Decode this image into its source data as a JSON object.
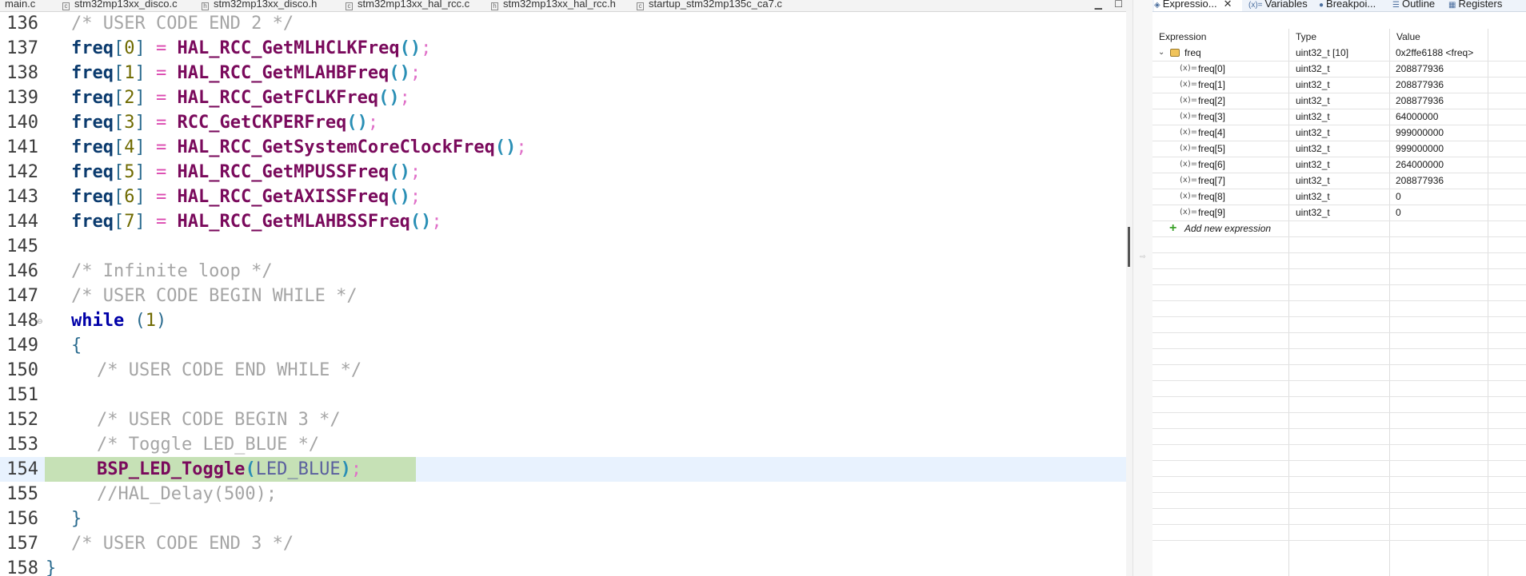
{
  "editor": {
    "tabs": [
      {
        "label": "main.c"
      },
      {
        "label": "stm32mp13xx_disco.c"
      },
      {
        "label": "stm32mp13xx_disco.h"
      },
      {
        "label": "stm32mp13xx_hal_rcc.c"
      },
      {
        "label": "stm32mp13xx_hal_rcc.h"
      },
      {
        "label": "startup_stm32mp135c_ca7.c"
      }
    ],
    "lines": [
      {
        "n": "136",
        "text": "/* USER CODE END 2 */"
      },
      {
        "n": "137",
        "var": "freq",
        "idx": "0",
        "fn": "HAL_RCC_GetMLHCLKFreq"
      },
      {
        "n": "138",
        "var": "freq",
        "idx": "1",
        "fn": "HAL_RCC_GetMLAHBFreq"
      },
      {
        "n": "139",
        "var": "freq",
        "idx": "2",
        "fn": "HAL_RCC_GetFCLKFreq"
      },
      {
        "n": "140",
        "var": "freq",
        "idx": "3",
        "fn": "RCC_GetCKPERFreq"
      },
      {
        "n": "141",
        "var": "freq",
        "idx": "4",
        "fn": "HAL_RCC_GetSystemCoreClockFreq"
      },
      {
        "n": "142",
        "var": "freq",
        "idx": "5",
        "fn": "HAL_RCC_GetMPUSSFreq"
      },
      {
        "n": "143",
        "var": "freq",
        "idx": "6",
        "fn": "HAL_RCC_GetAXISSFreq"
      },
      {
        "n": "144",
        "var": "freq",
        "idx": "7",
        "fn": "HAL_RCC_GetMLAHBSSFreq"
      },
      {
        "n": "145"
      },
      {
        "n": "146",
        "text": "/* Infinite loop */"
      },
      {
        "n": "147",
        "text": "/* USER CODE BEGIN WHILE */"
      },
      {
        "n": "148",
        "kw": "while",
        "cond": "1"
      },
      {
        "n": "149",
        "text": "{"
      },
      {
        "n": "150",
        "text": "/* USER CODE END WHILE */"
      },
      {
        "n": "151"
      },
      {
        "n": "152",
        "text": "/* USER CODE BEGIN 3 */"
      },
      {
        "n": "153",
        "text": "/* Toggle LED_BLUE */"
      },
      {
        "n": "154",
        "fn": "BSP_LED_Toggle",
        "arg": "LED_BLUE"
      },
      {
        "n": "155",
        "text": "//HAL_Delay(500);"
      },
      {
        "n": "156",
        "text": "}"
      },
      {
        "n": "157",
        "text": "/* USER CODE END 3 */"
      },
      {
        "n": "158",
        "text": "}"
      }
    ]
  },
  "panel": {
    "tabs": [
      {
        "label": "Expressio...",
        "icon": "expressions-icon",
        "active": true
      },
      {
        "label": "Variables",
        "icon": "variables-icon"
      },
      {
        "label": "Breakpoi...",
        "icon": "breakpoints-icon"
      },
      {
        "label": "Outline",
        "icon": "outline-icon"
      },
      {
        "label": "Registers",
        "icon": "registers-icon"
      }
    ],
    "columns": {
      "expression": "Expression",
      "type": "Type",
      "value": "Value"
    },
    "root": {
      "name": "freq",
      "type": "uint32_t [10]",
      "value": "0x2ffe6188 <freq>"
    },
    "children": [
      {
        "name": "freq[0]",
        "type": "uint32_t",
        "value": "208877936"
      },
      {
        "name": "freq[1]",
        "type": "uint32_t",
        "value": "208877936"
      },
      {
        "name": "freq[2]",
        "type": "uint32_t",
        "value": "208877936"
      },
      {
        "name": "freq[3]",
        "type": "uint32_t",
        "value": "64000000"
      },
      {
        "name": "freq[4]",
        "type": "uint32_t",
        "value": "999000000"
      },
      {
        "name": "freq[5]",
        "type": "uint32_t",
        "value": "999000000"
      },
      {
        "name": "freq[6]",
        "type": "uint32_t",
        "value": "264000000"
      },
      {
        "name": "freq[7]",
        "type": "uint32_t",
        "value": "208877936"
      },
      {
        "name": "freq[8]",
        "type": "uint32_t",
        "value": "0"
      },
      {
        "name": "freq[9]",
        "type": "uint32_t",
        "value": "0"
      }
    ],
    "add_label": "Add new expression"
  }
}
